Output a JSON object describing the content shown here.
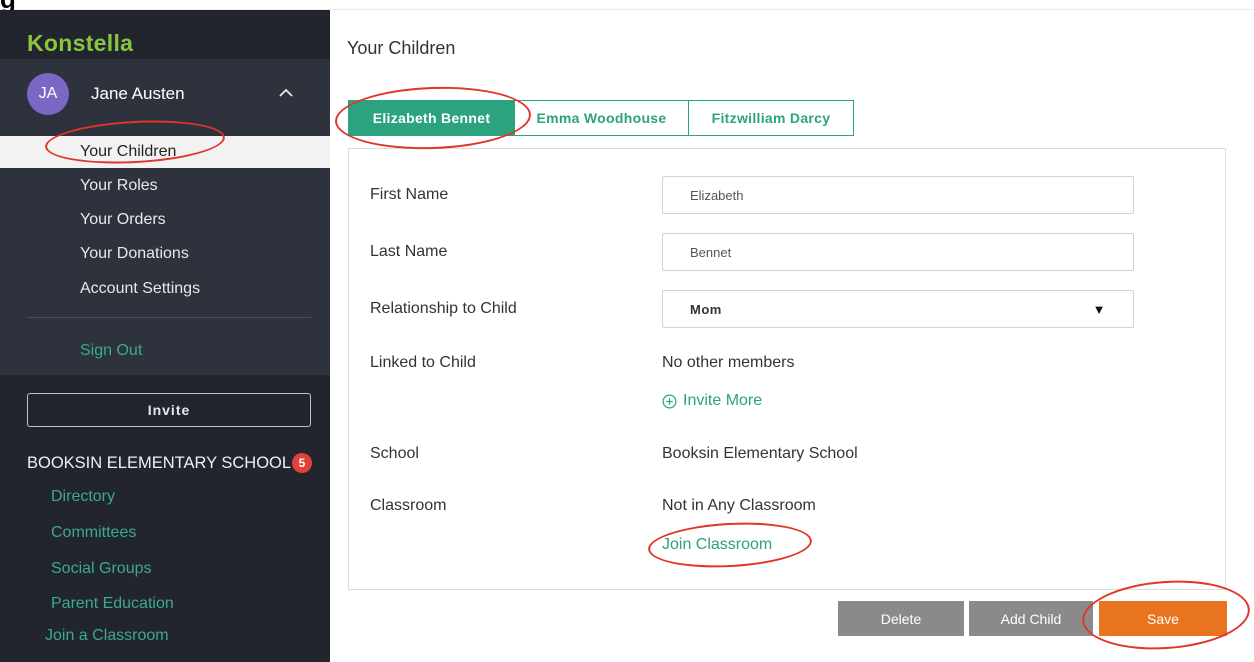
{
  "app": {
    "brand": "Konstella",
    "cut_heading": "g"
  },
  "user": {
    "initials": "JA",
    "name": "Jane Austen"
  },
  "sidebar": {
    "nav": [
      {
        "label": "Your Children",
        "active": true
      },
      {
        "label": "Your Roles"
      },
      {
        "label": "Your Orders"
      },
      {
        "label": "Your Donations"
      },
      {
        "label": "Account Settings"
      }
    ],
    "sign_out": "Sign Out",
    "invite_label": "Invite",
    "school": {
      "name": "BOOKSIN ELEMENTARY SCHOOL",
      "badge": "5",
      "links": [
        "Directory",
        "Committees",
        "Social Groups",
        "Parent Education"
      ]
    },
    "join_classroom": "Join a Classroom"
  },
  "main": {
    "title": "Your Children",
    "tabs": [
      {
        "label": "Elizabeth Bennet",
        "active": true
      },
      {
        "label": "Emma Woodhouse"
      },
      {
        "label": "Fitzwilliam Darcy"
      }
    ],
    "form": {
      "first_name_label": "First Name",
      "first_name_value": "Elizabeth",
      "last_name_label": "Last Name",
      "last_name_value": "Bennet",
      "relationship_label": "Relationship to Child",
      "relationship_value": "Mom",
      "linked_label": "Linked to Child",
      "linked_value": "No other members",
      "invite_more": "Invite More",
      "school_label": "School",
      "school_value": "Booksin Elementary School",
      "classroom_label": "Classroom",
      "classroom_value": "Not in Any Classroom",
      "join_classroom": "Join Classroom"
    },
    "buttons": {
      "delete": "Delete",
      "add_child": "Add Child",
      "save": "Save"
    }
  },
  "colors": {
    "accent_green": "#2aa37e",
    "brand_green": "#8ac53f",
    "save_orange": "#e8741f",
    "annotation_red": "#e0352b"
  }
}
